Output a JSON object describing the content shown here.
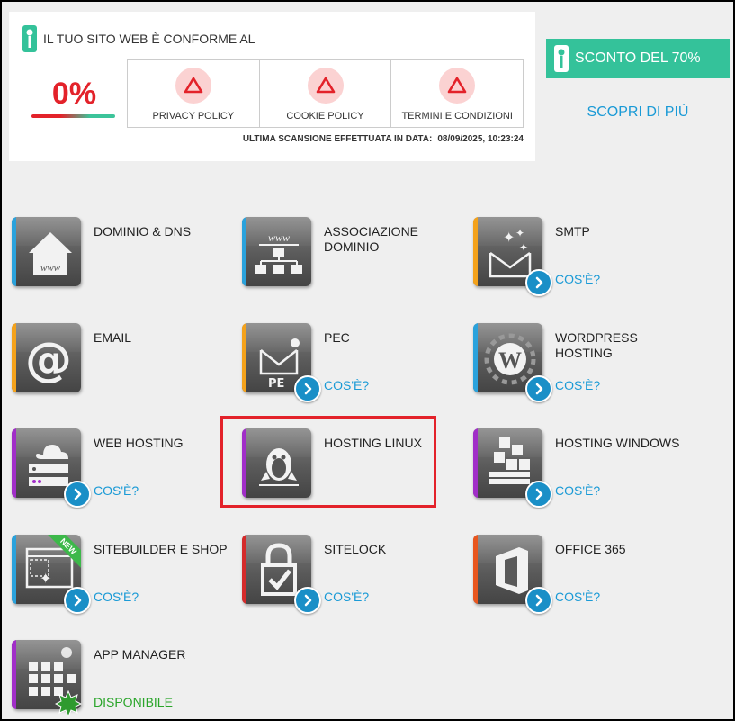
{
  "compliance": {
    "title": "IL TUO SITO WEB È CONFORME AL",
    "percent": "0%",
    "policies": [
      {
        "label": "PRIVACY POLICY"
      },
      {
        "label": "COOKIE POLICY"
      },
      {
        "label": "TERMINI E CONDIZIONI"
      }
    ],
    "scan_label": "ULTIMA SCANSIONE EFFETTUATA IN DATA:",
    "scan_date": "08/09/2025, 10:23:24"
  },
  "promo": {
    "button_label": "SCONTO DEL 70%",
    "link_label": "SCOPRI DI PIÙ"
  },
  "colors": {
    "accent_green": "#34c29a",
    "link_blue": "#1a9ad6",
    "alert_red": "#e3222a",
    "available_green": "#2aa52a"
  },
  "services": [
    {
      "label": "DOMINIO & DNS",
      "icon": "house-www-icon",
      "accent": "#2aa2dc"
    },
    {
      "label": "ASSOCIAZIONE DOMINIO",
      "icon": "www-network-icon",
      "accent": "#2aa2dc"
    },
    {
      "label": "SMTP",
      "icon": "mail-stars-icon",
      "accent": "#f4a21b",
      "link": "COS'È?"
    },
    {
      "label": "EMAIL",
      "icon": "at-sign-icon",
      "accent": "#f4a21b"
    },
    {
      "label": "PEC",
      "icon": "pec-mail-icon",
      "accent": "#f4a21b",
      "link": "COS'È?"
    },
    {
      "label": "WORDPRESS HOSTING",
      "icon": "wordpress-icon",
      "accent": "#2aa2dc",
      "link": "COS'È?"
    },
    {
      "label": "WEB HOSTING",
      "icon": "server-cloud-icon",
      "accent": "#a12ec8",
      "link": "COS'È?"
    },
    {
      "label": "HOSTING LINUX",
      "icon": "linux-penguin-icon",
      "accent": "#a12ec8"
    },
    {
      "label": "HOSTING WINDOWS",
      "icon": "stacked-cubes-icon",
      "accent": "#a12ec8",
      "link": "COS'È?"
    },
    {
      "label": "SITEBUILDER E SHOP",
      "icon": "sitebuilder-icon",
      "accent": "#2aa2dc",
      "link": "COS'È?",
      "badge": "NEW"
    },
    {
      "label": "SITELOCK",
      "icon": "padlock-check-icon",
      "accent": "#d42b2b",
      "link": "COS'È?"
    },
    {
      "label": "OFFICE 365",
      "icon": "office-icon",
      "accent": "#e8561e",
      "link": "COS'È?"
    },
    {
      "label": "APP MANAGER",
      "icon": "app-grid-icon",
      "accent": "#a12ec8",
      "link": "DISPONIBILE"
    }
  ]
}
